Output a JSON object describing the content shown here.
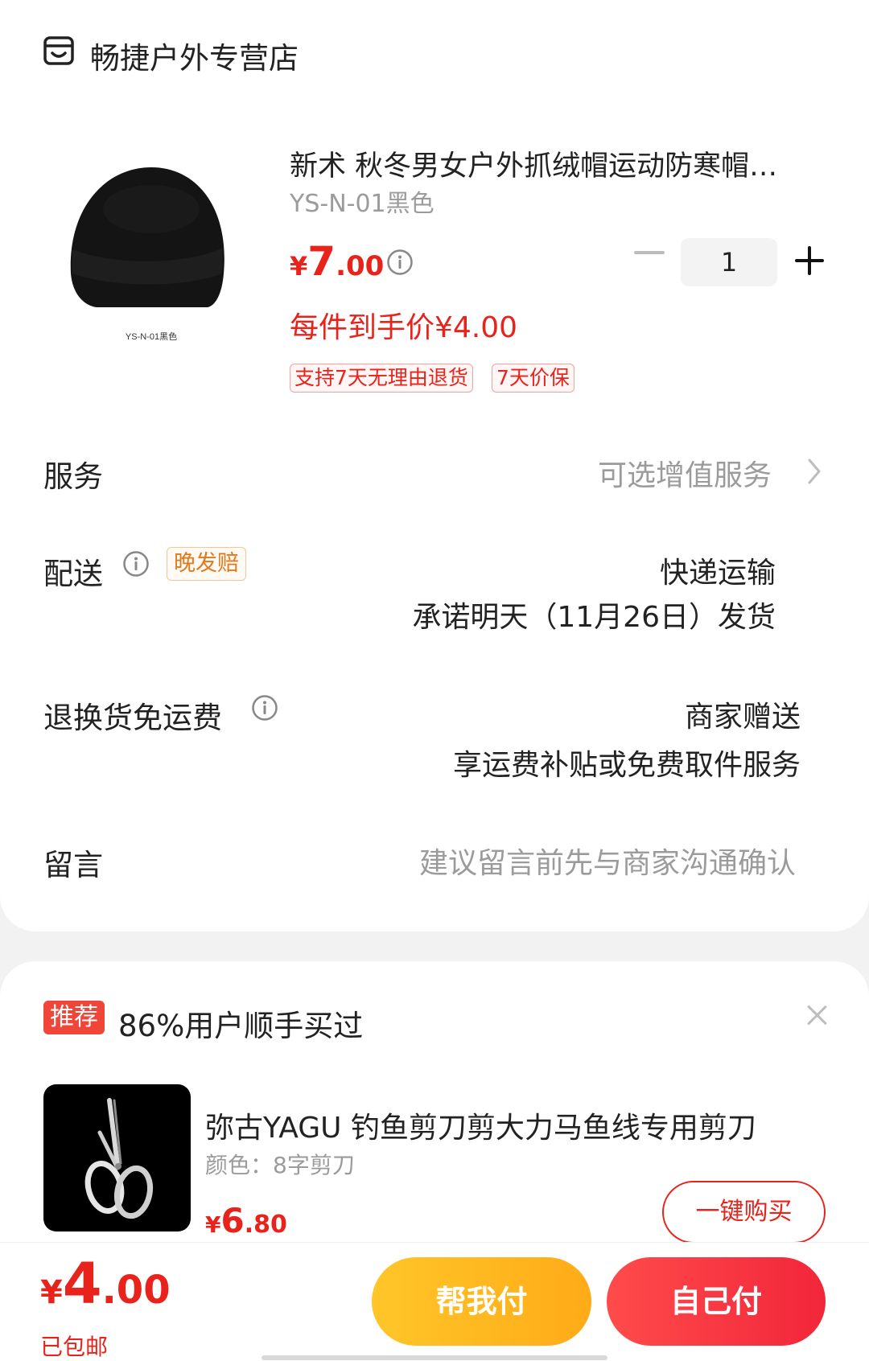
{
  "shop": {
    "name": "畅捷户外专营店",
    "icon": "shop-icon"
  },
  "product": {
    "title": "新术 秋冬男女户外抓绒帽运动防寒帽跑步保暖帽",
    "spec": "YS-N-01黑色",
    "image_caption": "YS-N-01黑色",
    "price_currency": "¥",
    "price_integer": "7",
    "price_decimal": ".00",
    "unit_price_text": "每件到手价¥4.00",
    "tags": [
      "支持7天无理由退货",
      "7天价保"
    ],
    "quantity": "1"
  },
  "service": {
    "label": "服务",
    "value": "可选增值服务"
  },
  "delivery": {
    "label": "配送",
    "badge": "晚发赔",
    "method": "快递运输",
    "promise": "承诺明天（11月26日）发货"
  },
  "return_shipping": {
    "label": "退换货免运费",
    "value": "商家赠送",
    "desc": "享运费补贴或免费取件服务"
  },
  "message": {
    "label": "留言",
    "placeholder": "建议留言前先与商家沟通确认"
  },
  "recommend": {
    "badge": "推荐",
    "title": "86%用户顺手买过",
    "product_title": "弥古YAGU 钓鱼剪刀剪大力马鱼线专用剪刀",
    "product_spec": "颜色：8字剪刀",
    "price_currency": "¥",
    "price_integer": "6",
    "price_decimal": ".80",
    "buy_label": "一键购买"
  },
  "bottom": {
    "total_currency": "¥",
    "total_integer": "4",
    "total_decimal": ".00",
    "shipping_note": "已包邮",
    "help_pay": "帮我付",
    "self_pay": "自己付"
  },
  "colors": {
    "accent": "#e8231c",
    "help_pay": "#ffb81c",
    "self_pay": "#f2263a",
    "late_badge": "#e07a1c"
  }
}
